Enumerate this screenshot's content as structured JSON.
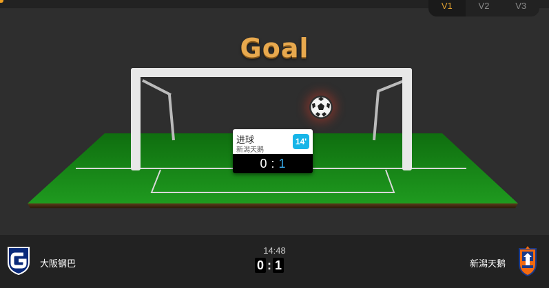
{
  "version_tabs": [
    "V1",
    "V2",
    "V3"
  ],
  "active_version": "V1",
  "animation": {
    "title": "Goal"
  },
  "goal_event": {
    "type_label": "进球",
    "team": "新潟天鹅",
    "minute": "14'",
    "score_home": "0",
    "score_sep": ":",
    "score_away": "1"
  },
  "match": {
    "time": "14:48",
    "home_team": "大阪钢巴",
    "away_team": "新潟天鹅",
    "home_score": "0",
    "away_score": "1",
    "score_sep": ":"
  },
  "colors": {
    "accent": "#e0a030",
    "goal_title": "#e8a94e",
    "minute_badge": "#17b5e8",
    "away_score": "#3aaef0",
    "pitch": "#1a8a1a",
    "background": "#2e2e2e"
  },
  "icons": {
    "ball": "soccer-ball-icon",
    "home_logo": "gamba-osaka-logo",
    "away_logo": "albirex-niigata-logo"
  }
}
